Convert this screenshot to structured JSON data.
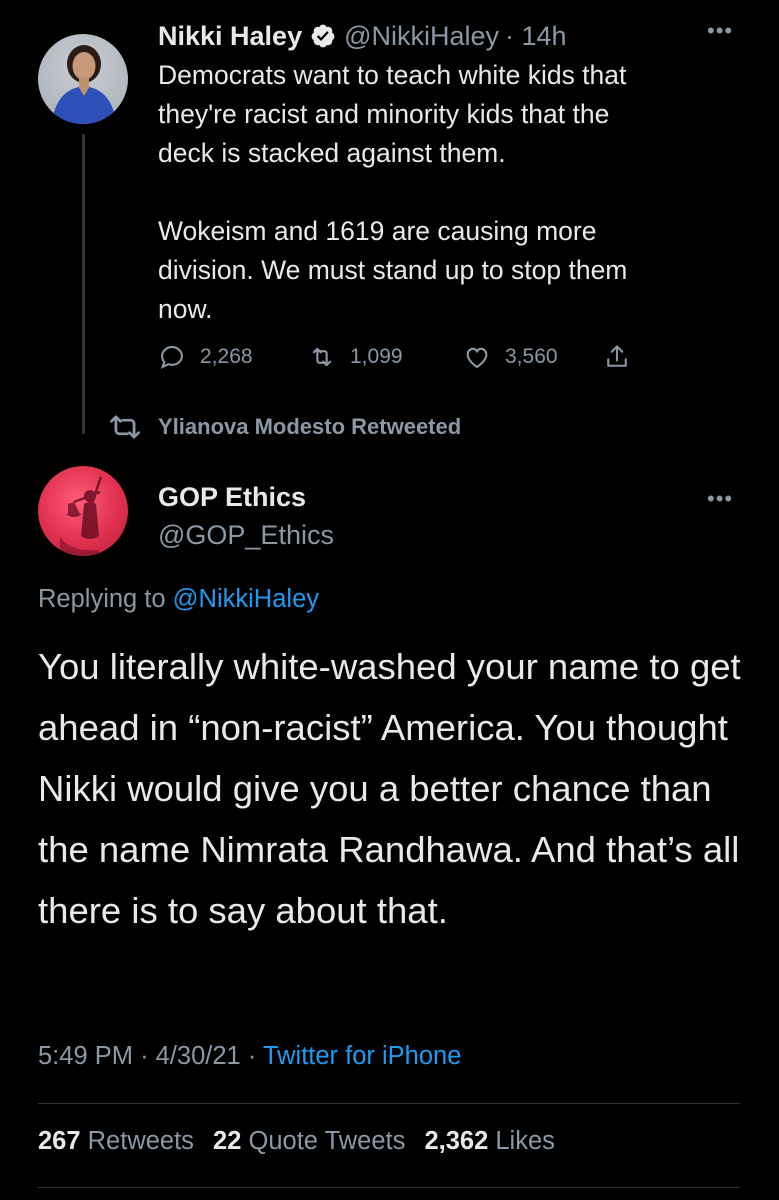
{
  "parent_tweet": {
    "author_name": "Nikki Haley",
    "verified": true,
    "author_handle": "@NikkiHaley",
    "time_ago": "· 14h",
    "text": "Democrats want to teach white kids that\nthey're racist and minority kids that the\ndeck is stacked against them.\n\nWokeism and 1619 are causing more\ndivision. We must stand up to stop them\nnow.",
    "replies": "2,268",
    "retweets": "1,099",
    "likes": "3,560",
    "icons": [
      "reply-icon",
      "retweet-icon",
      "like-icon",
      "share-icon",
      "more-icon",
      "verified-icon"
    ]
  },
  "retweet_context": {
    "label": "Ylianova Modesto Retweeted"
  },
  "main_tweet": {
    "author_name": "GOP Ethics",
    "author_handle": "@GOP_Ethics",
    "replying_prefix": "Replying to",
    "replying_to": "@NikkiHaley",
    "text": "You literally white-washed your name to get ahead in “non-racist” America. You thought Nikki would give you a better chance than the name Nimrata Randhawa. And that’s all there is to say about that.",
    "time": "5:49 PM",
    "date": "4/30/21",
    "client": "Twitter for iPhone",
    "stats": {
      "retweets_count": "267",
      "retweets_label": "Retweets",
      "quotes_count": "22",
      "quotes_label": "Quote Tweets",
      "likes_count": "2,362",
      "likes_label": "Likes"
    }
  },
  "colors": {
    "background": "#000000",
    "text": "#e7e9ea",
    "secondary": "#8b98a5",
    "link": "#1d9bf0",
    "divider": "#2f3336",
    "gop_avatar": "#e0304f"
  }
}
